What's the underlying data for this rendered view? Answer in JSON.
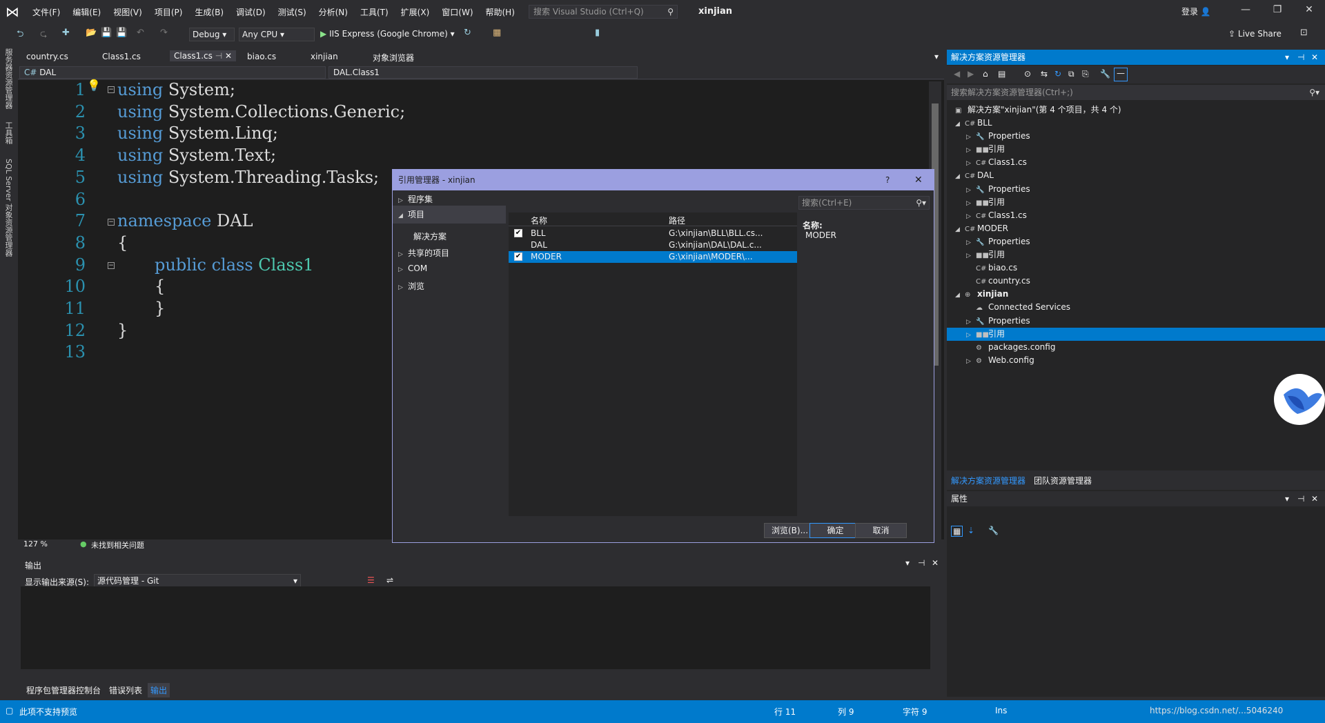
{
  "menubar": {
    "items": [
      "文件(F)",
      "编辑(E)",
      "视图(V)",
      "项目(P)",
      "生成(B)",
      "调试(D)",
      "测试(S)",
      "分析(N)",
      "工具(T)",
      "扩展(X)",
      "窗口(W)",
      "帮助(H)"
    ],
    "search_placeholder": "搜索 Visual Studio (Ctrl+Q)",
    "solution_title": "xinjian",
    "login": "登录"
  },
  "toolbar": {
    "config": "Debug",
    "platform": "Any CPU",
    "run_target": "IIS Express (Google Chrome)",
    "live_share": "Live Share"
  },
  "left_strip": [
    "服务器资源管理器",
    "工具箱",
    "SQL Server 对象资源管理器"
  ],
  "doc_tabs": [
    "country.cs",
    "Class1.cs",
    "Class1.cs",
    "biao.cs",
    "xinjian",
    "对象浏览器"
  ],
  "navbar": {
    "project": "DAL",
    "class": "DAL.Class1"
  },
  "editor": {
    "line_numbers": [
      "1",
      "2",
      "3",
      "4",
      "5",
      "6",
      "7",
      "8",
      "9",
      "10",
      "11",
      "12",
      "13"
    ],
    "lines": [
      {
        "kw": "using",
        "rest": " System;"
      },
      {
        "kw": "using",
        "rest": " System.Collections.Generic;"
      },
      {
        "kw": "using",
        "rest": " System.Linq;"
      },
      {
        "kw": "using",
        "rest": " System.Text;"
      },
      {
        "kw": "using",
        "rest": " System.Threading.Tasks;"
      },
      {
        "kw": "",
        "rest": ""
      },
      {
        "kw": "namespace",
        "rest": " DAL"
      },
      {
        "kw": "",
        "rest": "{"
      },
      {
        "kw": "public class",
        "rest": " Class1"
      },
      {
        "kw": "",
        "rest": "{"
      },
      {
        "kw": "",
        "rest": "}"
      },
      {
        "kw": "",
        "rest": "}"
      },
      {
        "kw": "",
        "rest": ""
      }
    ],
    "zoom": "127 %",
    "issues": "未找到相关问题"
  },
  "dialog": {
    "title": "引用管理器 - xinjian",
    "help": "?",
    "nav": [
      "程序集",
      "项目",
      "解决方案",
      "共享的项目",
      "COM",
      "浏览"
    ],
    "search_placeholder": "搜索(Ctrl+E)",
    "col_name": "名称",
    "col_path": "路径",
    "rows": [
      {
        "name": "BLL",
        "path": "G:\\xinjian\\BLL\\BLL.cs...",
        "checked": "✔"
      },
      {
        "name": "DAL",
        "path": "G:\\xinjian\\DAL\\DAL.c...",
        "checked": ""
      },
      {
        "name": "MODER",
        "path": "G:\\xinjian\\MODER\\...",
        "checked": "✔"
      }
    ],
    "detail_label": "名称:",
    "detail_value": "MODER",
    "btn_browse": "浏览(B)...",
    "btn_ok": "确定",
    "btn_cancel": "取消"
  },
  "output": {
    "title": "输出",
    "source_label": "显示输出来源(S):",
    "source_value": "源代码管理 - Git",
    "tabs": [
      "程序包管理器控制台",
      "错误列表",
      "输出"
    ]
  },
  "solution_explorer": {
    "title": "解决方案资源管理器",
    "search_placeholder": "搜索解决方案资源管理器(Ctrl+;)",
    "root": "解决方案\"xinjian\"(第 4 个项目，共 4 个)",
    "nodes": [
      {
        "label": "BLL",
        "icon": "C#"
      },
      {
        "label": "Properties",
        "icon": "🔧"
      },
      {
        "label": "引用",
        "icon": "■■"
      },
      {
        "label": "Class1.cs",
        "icon": "C#"
      },
      {
        "label": "DAL",
        "icon": "C#"
      },
      {
        "label": "Properties",
        "icon": "🔧"
      },
      {
        "label": "引用",
        "icon": "■■"
      },
      {
        "label": "Class1.cs",
        "icon": "C#"
      },
      {
        "label": "MODER",
        "icon": "C#"
      },
      {
        "label": "Properties",
        "icon": "🔧"
      },
      {
        "label": "引用",
        "icon": "■■"
      },
      {
        "label": "biao.cs",
        "icon": "C#"
      },
      {
        "label": "country.cs",
        "icon": "C#"
      },
      {
        "label": "xinjian",
        "icon": "⊕"
      },
      {
        "label": "Connected Services",
        "icon": "☁"
      },
      {
        "label": "Properties",
        "icon": "🔧"
      },
      {
        "label": "引用",
        "icon": "■■"
      },
      {
        "label": "packages.config",
        "icon": "⚙"
      },
      {
        "label": "Web.config",
        "icon": "⚙"
      }
    ],
    "tabs": [
      "解决方案资源管理器",
      "团队资源管理器"
    ]
  },
  "properties": {
    "title": "属性"
  },
  "statusbar": {
    "message": "此项不支持预览",
    "line": "行 11",
    "col": "列 9",
    "char": "字符 9",
    "mode": "Ins",
    "watermark": "https://blog.csdn.net/...5046240"
  }
}
